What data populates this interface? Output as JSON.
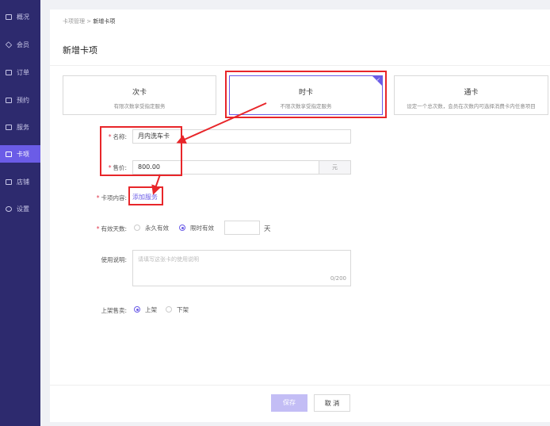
{
  "sidebar": {
    "items": [
      {
        "label": "概况",
        "icon": "overview-icon"
      },
      {
        "label": "会员",
        "icon": "member-icon"
      },
      {
        "label": "订单",
        "icon": "order-icon"
      },
      {
        "label": "预约",
        "icon": "appointment-icon"
      },
      {
        "label": "服务",
        "icon": "service-icon"
      },
      {
        "label": "卡项",
        "icon": "card-icon",
        "active": true
      },
      {
        "label": "店铺",
        "icon": "store-icon"
      },
      {
        "label": "设置",
        "icon": "settings-icon"
      }
    ]
  },
  "breadcrumb": {
    "parent": "卡项管理",
    "sep": ">",
    "current": "新增卡项"
  },
  "page_title": "新增卡项",
  "card_types": [
    {
      "title": "次卡",
      "desc": "有限次数享受指定服务"
    },
    {
      "title": "时卡",
      "desc": "不限次数享受指定服务",
      "selected": true
    },
    {
      "title": "通卡",
      "desc": "设定一个总次数，会员在次数内可选择消费卡内任意项目"
    }
  ],
  "form": {
    "name_label": "名称:",
    "name_value": "月内洗车卡",
    "price_label": "售价:",
    "price_value": "800.00",
    "price_unit": "元",
    "content_label": "卡项内容:",
    "add_service": "添加服务",
    "validity_label": "有效天数:",
    "validity_options": [
      "永久有效",
      "限时有效"
    ],
    "validity_selected": 1,
    "days_unit": "天",
    "usage_label": "使用说明:",
    "usage_placeholder": "请填写这张卡的使用说明",
    "usage_count": "0/200",
    "shelf_label": "上架售卖:",
    "shelf_options": [
      "上架",
      "下架"
    ],
    "shelf_selected": 0,
    "required_mark": "*"
  },
  "footer": {
    "save": "保存",
    "cancel": "取 消"
  },
  "colors": {
    "accent": "#6b5ce7",
    "sidebar": "#2d2a6e",
    "annotation": "#e8262a"
  }
}
